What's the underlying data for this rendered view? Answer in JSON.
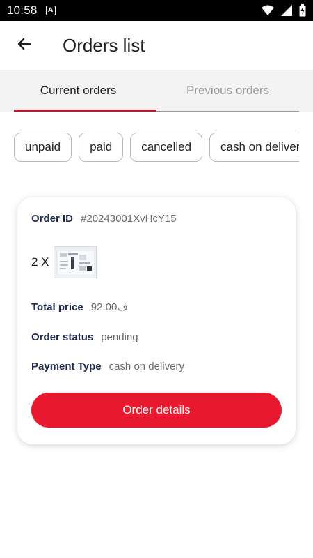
{
  "status_bar": {
    "time": "10:58",
    "notification_icon": "a-badge-icon",
    "right_icons": [
      "wifi-icon",
      "cell-signal-icon",
      "battery-charging-icon"
    ]
  },
  "app_bar": {
    "back_icon": "arrow-left-icon",
    "title": "Orders list"
  },
  "tabs": [
    {
      "label": "Current orders",
      "selected": true
    },
    {
      "label": "Previous orders",
      "selected": false
    }
  ],
  "filters": [
    "unpaid",
    "paid",
    "cancelled",
    "cash on delivery"
  ],
  "order": {
    "id_label": "Order ID",
    "id_value": "#20243001XvHcY15",
    "quantity": "2 X",
    "thumbnail_icon": "product-thumbnail",
    "total_label": "Total price",
    "total_value": "ف92.00",
    "status_label": "Order status",
    "status_value": "pending",
    "payment_label": "Payment Type",
    "payment_value": "cash on delivery",
    "details_button": "Order details"
  },
  "colors": {
    "accent": "#e8192f",
    "tab_indicator": "#b81c2c",
    "label_navy": "#1d2b4f"
  }
}
